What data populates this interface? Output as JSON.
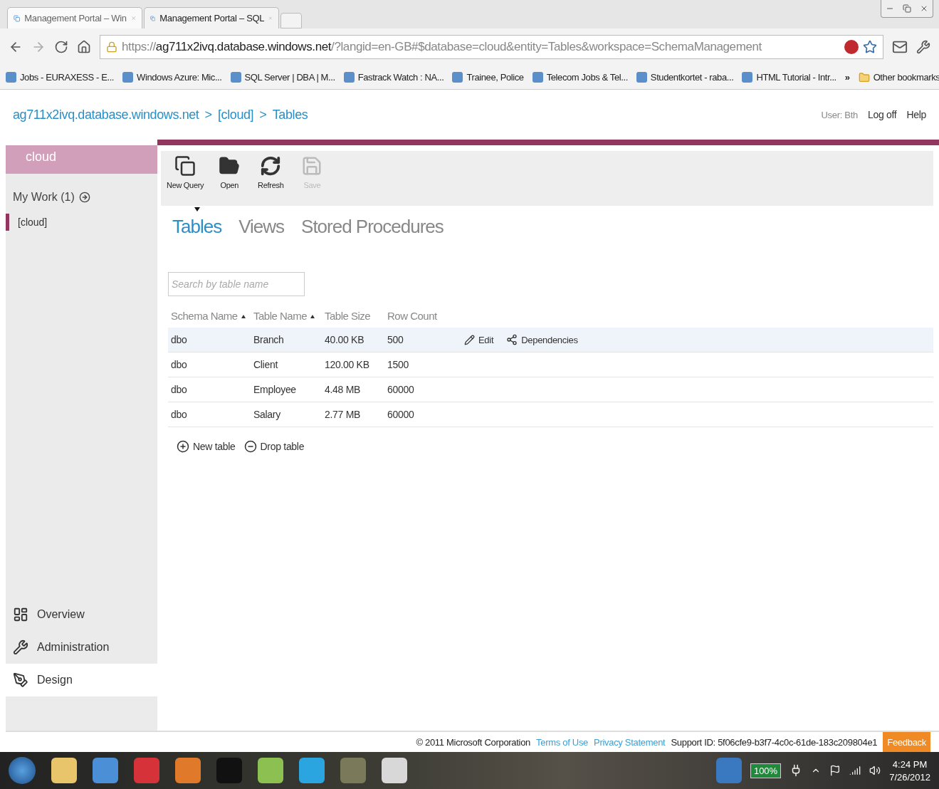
{
  "browser": {
    "tabs": [
      {
        "label": "Management Portal – Win",
        "selected": false
      },
      {
        "label": "Management Portal – SQL",
        "selected": true
      }
    ],
    "address": {
      "scheme": "https://",
      "host": "ag711x2ivq.database.windows.net",
      "path": "/?langid=en-GB#$database=cloud&entity=Tables&workspace=SchemaManagement"
    },
    "bookmarks": [
      "Jobs - EURAXESS - E...",
      "Windows Azure: Mic...",
      "SQL Server | DBA | M...",
      "Fastrack Watch : NA...",
      "Trainee, Police",
      "Telecom Jobs & Tel...",
      "Studentkortet - raba...",
      "HTML Tutorial - Intr..."
    ],
    "bookmarks_more": "»",
    "other_bookmarks": "Other bookmarks"
  },
  "header": {
    "breadcrumb": [
      "ag711x2ivq.database.windows.net",
      ">",
      "[cloud]",
      ">",
      "Tables"
    ],
    "user": "User: Bth",
    "links": [
      "Log off",
      "Help"
    ]
  },
  "sidebar": {
    "title": "cloud",
    "my_work": "My Work (1)",
    "items": [
      {
        "label": "[cloud]",
        "selected": true
      }
    ],
    "nav": [
      {
        "label": "Overview",
        "selected": false
      },
      {
        "label": "Administration",
        "selected": false
      },
      {
        "label": "Design",
        "selected": true
      }
    ]
  },
  "toolbar": [
    {
      "kind": "query",
      "label": "New Query",
      "disabled": false
    },
    {
      "kind": "open",
      "label": "Open",
      "disabled": false
    },
    {
      "kind": "refresh",
      "label": "Refresh",
      "disabled": false
    },
    {
      "kind": "save",
      "label": "Save",
      "disabled": true
    }
  ],
  "tabs": [
    {
      "label": "Tables",
      "selected": true
    },
    {
      "label": "Views",
      "selected": false
    },
    {
      "label": "Stored Procedures",
      "selected": false
    }
  ],
  "search": {
    "placeholder": "Search by table name"
  },
  "table": {
    "columns": [
      {
        "label": "Schema Name",
        "sorted": true
      },
      {
        "label": "Table Name",
        "sorted": true
      },
      {
        "label": "Table Size",
        "sorted": false
      },
      {
        "label": "Row Count",
        "sorted": false
      }
    ],
    "rows": [
      {
        "cells": [
          "dbo",
          "Branch",
          "40.00 KB",
          "500"
        ],
        "selected": true
      },
      {
        "cells": [
          "dbo",
          "Client",
          "120.00 KB",
          "1500"
        ],
        "selected": false
      },
      {
        "cells": [
          "dbo",
          "Employee",
          "4.48 MB",
          "60000"
        ],
        "selected": false
      },
      {
        "cells": [
          "dbo",
          "Salary",
          "2.77 MB",
          "60000"
        ],
        "selected": false
      }
    ],
    "row_actions": [
      {
        "kind": "edit",
        "label": "Edit"
      },
      {
        "kind": "dependencies",
        "label": "Dependencies"
      }
    ]
  },
  "actions": [
    {
      "kind": "new",
      "label": "New table"
    },
    {
      "kind": "drop",
      "label": "Drop table"
    }
  ],
  "footer": {
    "copyright": "© 2011 Microsoft Corporation",
    "links": [
      "Terms of Use",
      "Privacy Statement"
    ],
    "support": "Support ID: 5f06cfe9-b3f7-4c0c-61de-183c209804e1",
    "feedback": "Feedback"
  },
  "taskbar": {
    "battery": "100%",
    "time": "4:24 PM",
    "date": "7/26/2012"
  }
}
